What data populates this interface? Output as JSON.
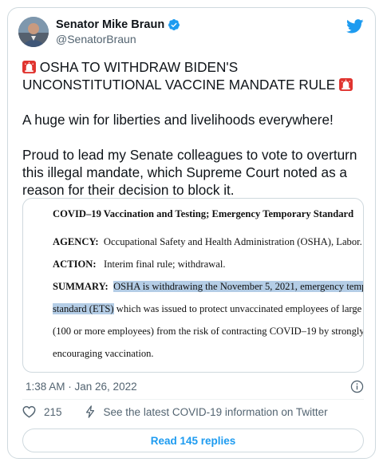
{
  "author": {
    "display_name": "Senator Mike Braun",
    "handle": "@SenatorBraun",
    "verified": true
  },
  "tweet": {
    "paragraph1_line1": "OSHA TO WITHDRAW BIDEN'S",
    "paragraph1_line2": "UNCONSTITUTIONAL VACCINE MANDATE RULE",
    "paragraph2": "A huge win for liberties and livelihoods everywhere!",
    "paragraph3_line1": "Proud to lead my Senate colleagues to vote to overturn",
    "paragraph3_line2": "this illegal mandate, which Supreme Court noted as a",
    "paragraph3_line3": "reason for their decision to block it."
  },
  "document": {
    "title": "COVID–19 Vaccination and Testing; Emergency Temporary Standard",
    "agency_label": "AGENCY:",
    "agency_text": "Occupational Safety and Health Administration (OSHA), Labor.",
    "action_label": "ACTION:",
    "action_text": "Interim final rule; withdrawal.",
    "summary_label": "SUMMARY:",
    "summary_highlight": "OSHA is withdrawing the November 5, 2021, emergency temp",
    "line2_highlight": "standard (ETS)",
    "line2_rest": " which was issued to protect unvaccinated employees of large c",
    "line3": "(100 or more employees) from the risk of contracting COVID–19 by strongly",
    "line4": "encouraging vaccination."
  },
  "meta": {
    "timestamp": "1:38 AM · Jan 26, 2022"
  },
  "actions": {
    "like_count": "215",
    "covid_info": "See the latest COVID-19 information on Twitter",
    "read_replies": "Read 145 replies"
  },
  "icons": {
    "avatar": "profile-photo",
    "verified": "verified-badge-icon",
    "logo": "twitter-bird-icon",
    "siren": "police-light-emoji",
    "info": "info-icon",
    "like": "heart-icon",
    "bolt": "lightning-icon"
  },
  "colors": {
    "accent": "#1d9bf0",
    "text": "#0f1419",
    "secondary": "#536471",
    "border": "#cfd9de",
    "highlight": "#b4cde6"
  }
}
